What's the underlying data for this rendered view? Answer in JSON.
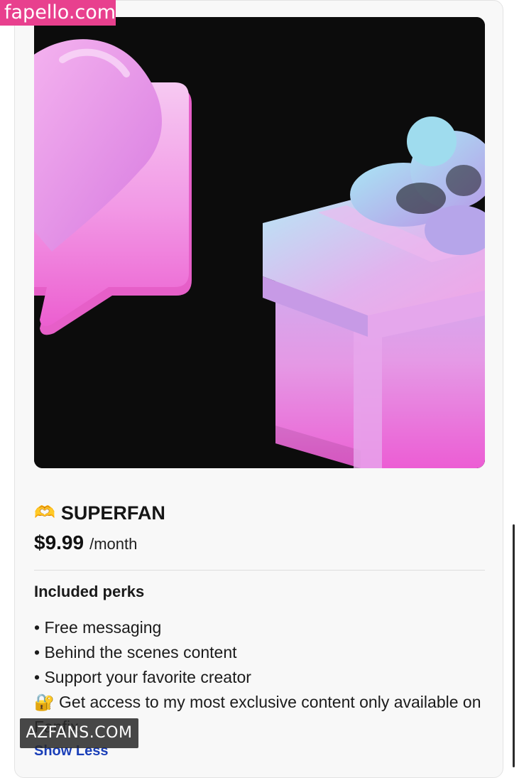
{
  "watermarks": {
    "top": "fapello.com",
    "bottom": "AZFANS.COM"
  },
  "tier": {
    "icon": "heart-hands-icon",
    "icon_glyph": "🫶",
    "name": "SUPERFAN",
    "price": "$9.99",
    "period": "/month"
  },
  "perks": {
    "heading": "Included perks",
    "items": [
      "• Free messaging",
      "• Behind the scenes content",
      "• Support your favorite creator"
    ],
    "exclusive_icon": "lock-key-icon",
    "exclusive_glyph": "🔐",
    "exclusive_text": "Get access to my most exclusive content only available on Fanfix"
  },
  "actions": {
    "show_less": "Show Less"
  },
  "colors": {
    "hero_background": "#0c0c0c",
    "accent_pink": "#e8408e",
    "link_blue": "#1a3fb8"
  }
}
